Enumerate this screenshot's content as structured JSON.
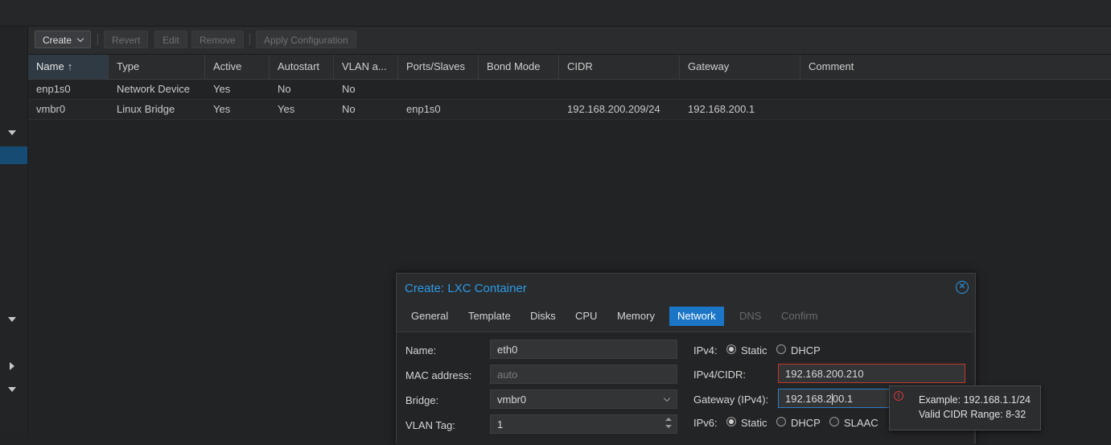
{
  "toolbar": {
    "create_label": "Create",
    "revert_label": "Revert",
    "edit_label": "Edit",
    "remove_label": "Remove",
    "apply_label": "Apply Configuration"
  },
  "grid": {
    "columns": [
      "Name",
      "Type",
      "Active",
      "Autostart",
      "VLAN a...",
      "Ports/Slaves",
      "Bond Mode",
      "CIDR",
      "Gateway",
      "Comment"
    ],
    "sort_icon": "arrow-up-icon",
    "sort_glyph": "↑",
    "rows": [
      {
        "name": "enp1s0",
        "type": "Network Device",
        "active": "Yes",
        "autostart": "No",
        "vlan": "No",
        "ports": "",
        "bond": "",
        "cidr": "",
        "gateway": "",
        "comment": ""
      },
      {
        "name": "vmbr0",
        "type": "Linux Bridge",
        "active": "Yes",
        "autostart": "Yes",
        "vlan": "No",
        "ports": "enp1s0",
        "bond": "",
        "cidr": "192.168.200.209/24",
        "gateway": "192.168.200.1",
        "comment": ""
      }
    ]
  },
  "dialog": {
    "title": "Create: LXC Container",
    "close_icon": "close-circle-icon",
    "tabs": [
      {
        "label": "General",
        "state": "normal"
      },
      {
        "label": "Template",
        "state": "normal"
      },
      {
        "label": "Disks",
        "state": "normal"
      },
      {
        "label": "CPU",
        "state": "normal"
      },
      {
        "label": "Memory",
        "state": "normal"
      },
      {
        "label": "Network",
        "state": "active"
      },
      {
        "label": "DNS",
        "state": "disabled"
      },
      {
        "label": "Confirm",
        "state": "disabled"
      }
    ],
    "fields": {
      "name_label": "Name:",
      "name_value": "eth0",
      "mac_label": "MAC address:",
      "mac_placeholder": "auto",
      "bridge_label": "Bridge:",
      "bridge_value": "vmbr0",
      "vlan_label": "VLAN Tag:",
      "vlan_value": "1",
      "ipv4_label": "IPv4:",
      "ipv4_static": "Static",
      "ipv4_dhcp": "DHCP",
      "ipv4_selected": "Static",
      "ipv4cidr_label": "IPv4/CIDR:",
      "ipv4cidr_value": "192.168.200.210",
      "gw4_label": "Gateway (IPv4):",
      "gw4_value_before_cursor": "192.168.2",
      "gw4_value_after_cursor": "00.1",
      "ipv6_label": "IPv6:",
      "ipv6_static": "Static",
      "ipv6_dhcp": "DHCP",
      "ipv6_slaac": "SLAAC",
      "ipv6_selected": "Static"
    }
  },
  "tooltip": {
    "icon": "error-icon",
    "line1": "Example: 192.168.1.1/24",
    "line2": "Valid CIDR Range: 8-32"
  },
  "colors": {
    "accent": "#1c76c8",
    "title_blue": "#2d9be7",
    "error_red": "#c0392b"
  }
}
